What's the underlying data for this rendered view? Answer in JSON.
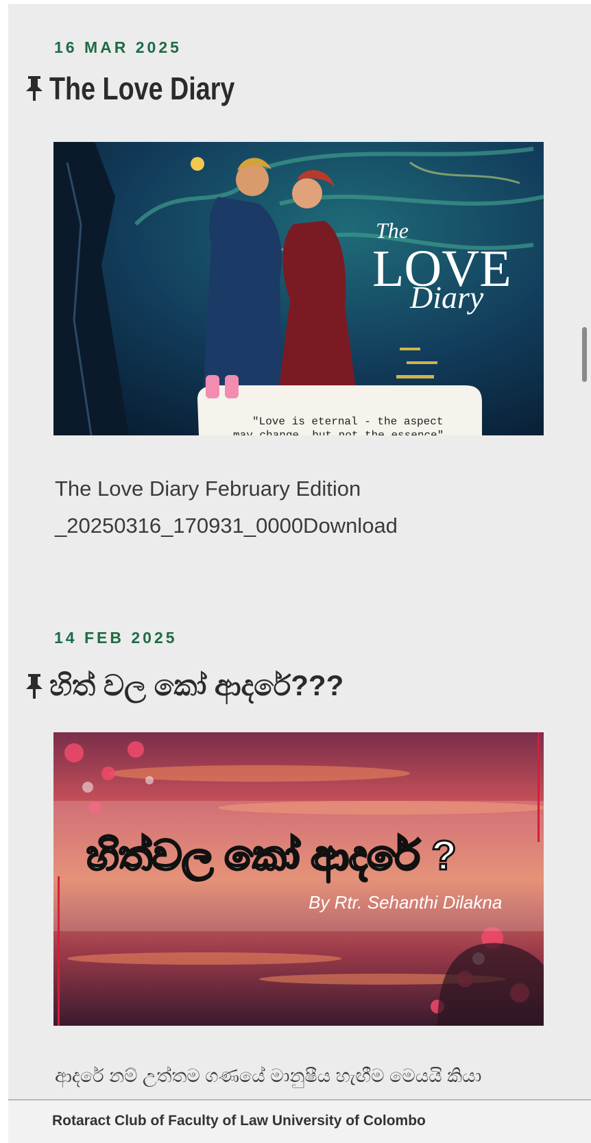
{
  "colors": {
    "date_green": "#1e6b45",
    "background": "#ececec",
    "title_text": "#2b2b2b",
    "body_text": "#3a3a3a"
  },
  "posts": [
    {
      "date": "16 MAR 2025",
      "pin_icon": "pushpin-icon",
      "title": "The Love Diary",
      "image": {
        "title_small": "The",
        "title_large": "LOVE",
        "title_script": "Diary",
        "quote_line1": "\"Love is eternal - the aspect",
        "quote_line2": "may change, but not the essence\""
      },
      "excerpt_line1": "The Love Diary February Edition",
      "excerpt_line2": "_20250316_170931_0000Download"
    },
    {
      "date": "14 FEB 2025",
      "pin_icon": "pushpin-icon",
      "title": "හිත් වල කෝ ආදරේ???",
      "image": {
        "banner_text": "හිත්වල කෝ ආදරේ ?",
        "byline": "By Rtr. Sehanthi Dilakna"
      },
      "excerpt_line1": "ආදරේ නම් උත්තම ගණයේ මානුෂීය හැඟීම මෙයයි කියා"
    }
  ],
  "footer": {
    "site_name": "Rotaract Club of Faculty of Law University of Colombo"
  }
}
